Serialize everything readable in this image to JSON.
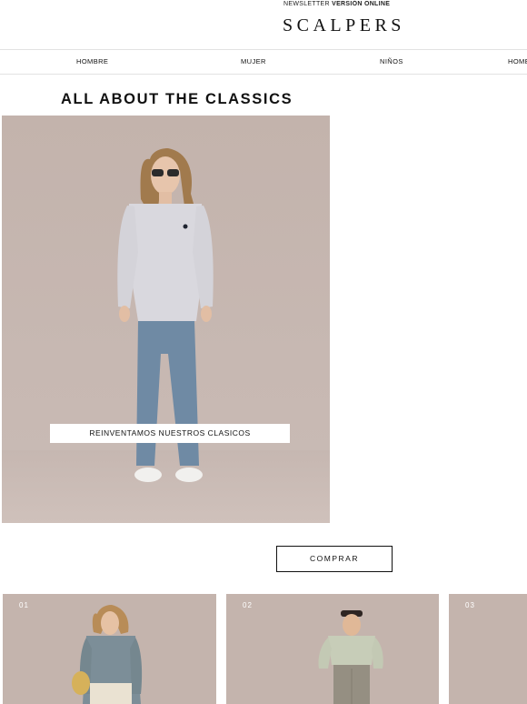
{
  "header": {
    "newsletter_label": "NEWSLETTER",
    "online_label": "VERSIÓN ONLINE",
    "logo": "SCALPERS"
  },
  "nav": {
    "items": [
      {
        "label": "HOMBRE"
      },
      {
        "label": "MUJER"
      },
      {
        "label": "NIÑOS"
      },
      {
        "label": "HOME"
      }
    ]
  },
  "main": {
    "headline": "ALL ABOUT THE CLASSICS",
    "hero_banner": "REINVENTAMOS NUESTROS CLASICOS",
    "cta": "COMPRAR"
  },
  "cards": [
    {
      "number": "01"
    },
    {
      "number": "02"
    },
    {
      "number": "03"
    }
  ],
  "colors": {
    "background": "#ffffff",
    "text": "#111111",
    "photo_backdrop": "#c4b4ad"
  }
}
